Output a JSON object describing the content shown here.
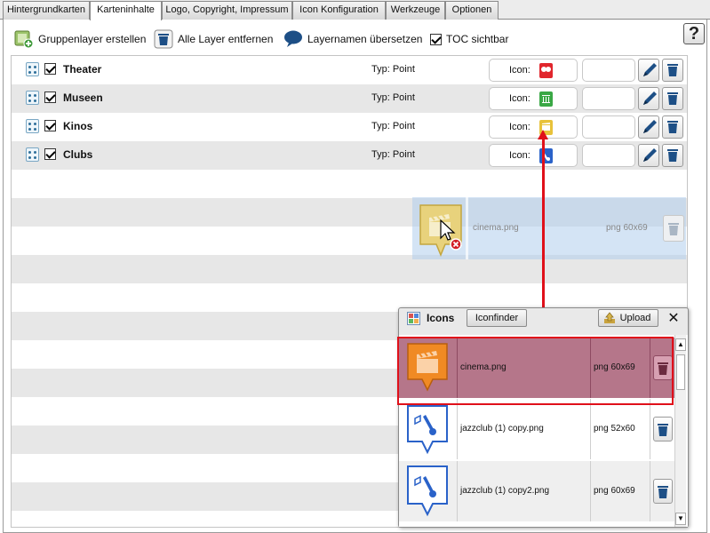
{
  "tabs": [
    {
      "label": "Hintergrundkarten"
    },
    {
      "label": "Karteninhalte",
      "active": true
    },
    {
      "label": "Logo, Copyright, Impressum"
    },
    {
      "label": "Icon Konfiguration"
    },
    {
      "label": "Werkzeuge"
    },
    {
      "label": "Optionen"
    }
  ],
  "toolbar": {
    "add_group_label": "Gruppenlayer erstellen",
    "remove_all_label": "Alle Layer entfernen",
    "translate_label": "Layernamen übersetzen",
    "toc_label": "TOC sichtbar",
    "toc_checked": true,
    "help_label": "?"
  },
  "layers": [
    {
      "name": "Theater",
      "type": "Typ: Point",
      "icon_label": "Icon:",
      "checked": true,
      "icon": "theater-icon",
      "icon_color": "#e1262d"
    },
    {
      "name": "Museen",
      "type": "Typ: Point",
      "icon_label": "Icon:",
      "checked": true,
      "icon": "museum-icon",
      "icon_color": "#3aa845"
    },
    {
      "name": "Kinos",
      "type": "Typ: Point",
      "icon_label": "Icon:",
      "checked": true,
      "icon": "cinema-icon",
      "icon_color": "#e8c23a"
    },
    {
      "name": "Clubs",
      "type": "Typ: Point",
      "icon_label": "Icon:",
      "checked": true,
      "icon": "club-icon",
      "icon_color": "#2a62c9"
    }
  ],
  "drag_ghost": {
    "name": "cinema.png",
    "size": "png 60x69",
    "icon_color": "#e8c23a"
  },
  "icons_dialog": {
    "title": "Icons",
    "iconfinder_label": "Iconfinder",
    "upload_label": "Upload",
    "close_label": "✕",
    "items": [
      {
        "name": "cinema.png",
        "size": "png 60x69",
        "icon": "cinema-icon",
        "color": "#f08a24",
        "selected": true
      },
      {
        "name": "jazzclub (1) copy.png",
        "size": "png 52x60",
        "icon": "jazzclub-icon",
        "color": "#2a62c9"
      },
      {
        "name": "jazzclub (1) copy2.png",
        "size": "png 60x69",
        "icon": "jazzclub-icon",
        "color": "#2a62c9"
      }
    ]
  },
  "colors": {
    "highlight": "#e0101a",
    "selected_row": "#b5768a",
    "drag_ghost": "#b0cdec"
  }
}
